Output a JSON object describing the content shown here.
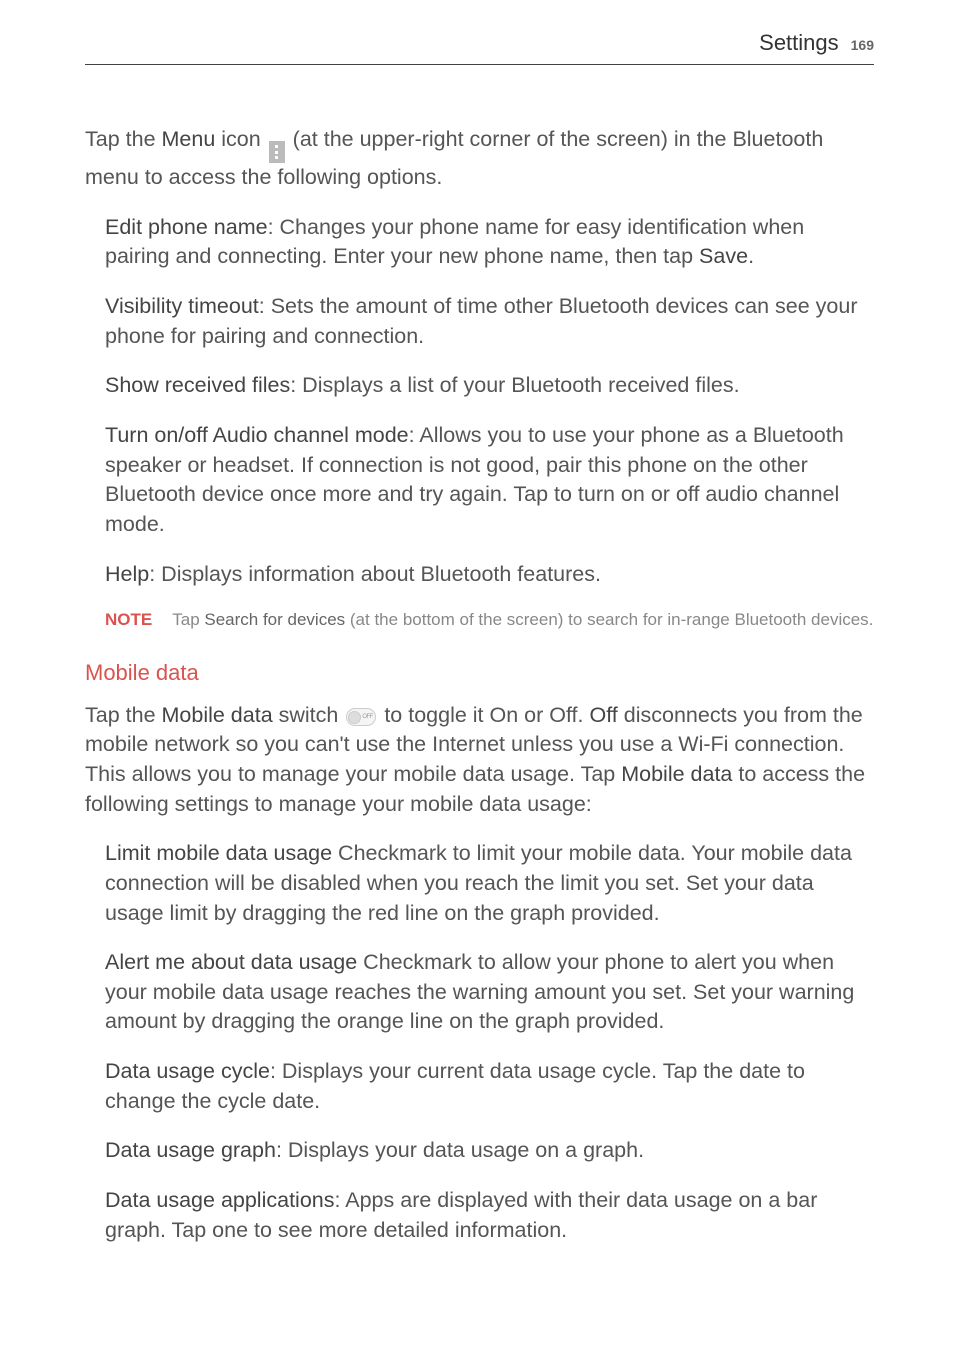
{
  "header": {
    "title": "Settings",
    "page": "169"
  },
  "intro": {
    "pre": "Tap the ",
    "bold1": "Menu",
    "mid": " icon ",
    "post": " (at the upper-right corner of the screen) in the Bluetooth menu to access the following options."
  },
  "items1": [
    {
      "bold": "Edit phone name",
      "text": ": Changes your phone name for easy identification when pairing and connecting. Enter your new phone name, then tap ",
      "bold2": "Save",
      "tail": "."
    },
    {
      "bold": "Visibility timeout",
      "text": ": Sets the amount of time other Bluetooth devices can see your phone for pairing and connection."
    },
    {
      "bold": "Show received files",
      "text": ": Displays a list of your Bluetooth received files."
    },
    {
      "bold": "Turn on/off Audio channel mode",
      "text": ": Allows you to use your phone as a Bluetooth speaker or headset. If connection is not good, pair this phone on the other Bluetooth device once more and try again. Tap to turn on or off audio channel mode."
    },
    {
      "bold": "Help",
      "text": ": Displays information about Bluetooth features."
    }
  ],
  "note": {
    "label": "NOTE",
    "pre": "Tap ",
    "bold": "Search for devices",
    "post": " (at the bottom of the screen) to search for in-range Bluetooth devices."
  },
  "section2": {
    "title": "Mobile data",
    "intro_pre": "Tap the ",
    "intro_b1": "Mobile data",
    "intro_mid1": " switch ",
    "intro_mid2": " to toggle it On or Off. ",
    "intro_b2": "Off",
    "intro_mid3": " disconnects you from the mobile network so you can't use the Internet unless you use a Wi-Fi connection. This allows you to manage your mobile data usage. Tap ",
    "intro_b3": "Mobile data",
    "intro_post": " to access the following settings to manage your mobile data usage:"
  },
  "items2": [
    {
      "bold": "Limit mobile data usage",
      "text": " Checkmark to limit your mobile data. Your mobile data connection will be disabled when you reach the limit you set. Set your data usage limit by dragging the red line on the graph provided."
    },
    {
      "bold": "Alert me about data usage",
      "text": " Checkmark to allow your phone to alert you when your mobile data usage reaches the warning amount you set. Set your warning amount by dragging the orange line on the graph provided."
    },
    {
      "bold": "Data usage cycle",
      "text": ": Displays your current data usage cycle. Tap the date to change the cycle date."
    },
    {
      "bold": "Data usage graph",
      "text": ": Displays your data usage on a graph."
    },
    {
      "bold": "Data usage applications",
      "text": ": Apps are displayed with their data usage on a bar graph. Tap one to see more detailed information."
    }
  ]
}
